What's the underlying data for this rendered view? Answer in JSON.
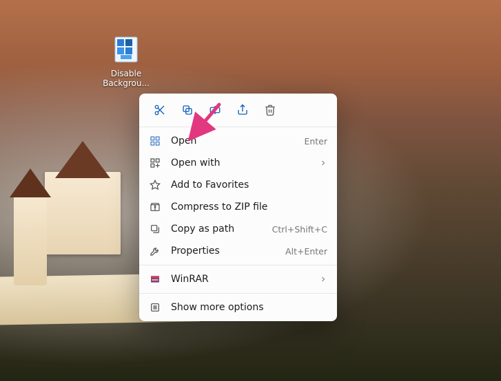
{
  "desktop": {
    "icon_name": "Disable Backgrou..."
  },
  "context_menu": {
    "toolbar": {
      "cut": "Cut",
      "copy": "Copy",
      "rename": "Rename",
      "share": "Share",
      "delete": "Delete"
    },
    "items": [
      {
        "id": "open",
        "label": "Open",
        "accel": "Enter",
        "icon": "grid-icon",
        "submenu": false
      },
      {
        "id": "open-with",
        "label": "Open with",
        "accel": "",
        "icon": "apps-icon",
        "submenu": true
      },
      {
        "id": "favorites",
        "label": "Add to Favorites",
        "accel": "",
        "icon": "star-icon",
        "submenu": false
      },
      {
        "id": "compress",
        "label": "Compress to ZIP file",
        "accel": "",
        "icon": "zip-icon",
        "submenu": false
      },
      {
        "id": "copy-path",
        "label": "Copy as path",
        "accel": "Ctrl+Shift+C",
        "icon": "path-icon",
        "submenu": false
      },
      {
        "id": "properties",
        "label": "Properties",
        "accel": "Alt+Enter",
        "icon": "wrench-icon",
        "submenu": false
      }
    ],
    "extra": [
      {
        "id": "winrar",
        "label": "WinRAR",
        "accel": "",
        "icon": "winrar-icon",
        "submenu": true
      }
    ],
    "more": {
      "id": "more-options",
      "label": "Show more options",
      "accel": "",
      "icon": "more-icon"
    }
  },
  "annotation": {
    "arrow_color": "#e1387f",
    "target": "open"
  }
}
